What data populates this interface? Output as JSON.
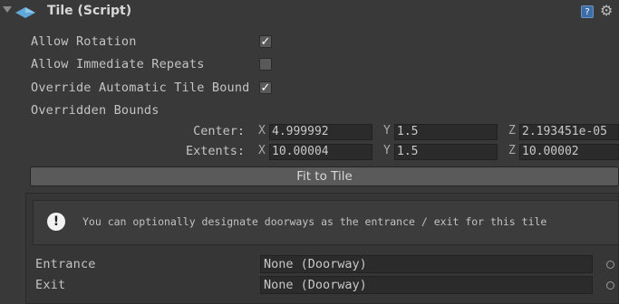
{
  "header": {
    "title": "Tile (Script)",
    "help_icon": "?",
    "gear_icon": "⚙"
  },
  "properties": {
    "allow_rotation": {
      "label": "Allow Rotation",
      "checked": true,
      "mark": "✓"
    },
    "allow_immediate_repeats": {
      "label": "Allow Immediate Repeats",
      "checked": false,
      "mark": ""
    },
    "override_bounds": {
      "label": "Override Automatic Tile Bound",
      "checked": true,
      "mark": "✓"
    },
    "overridden_bounds": {
      "label": "Overridden Bounds"
    }
  },
  "bounds": {
    "center": {
      "label": "Center:",
      "x_label": "X",
      "x": "4.999992",
      "y_label": "Y",
      "y": "1.5",
      "z_label": "Z",
      "z": "2.193451e-05"
    },
    "extents": {
      "label": "Extents:",
      "x_label": "X",
      "x": "10.00004",
      "y_label": "Y",
      "y": "1.5",
      "z_label": "Z",
      "z": "10.00002"
    }
  },
  "fit_button": "Fit to Tile",
  "info": {
    "icon": "!",
    "text": "You can optionally designate doorways as the entrance / exit for this tile"
  },
  "doorways": {
    "entrance": {
      "label": "Entrance",
      "value": "None (Doorway)"
    },
    "exit": {
      "label": "Exit",
      "value": "None (Doorway)"
    }
  },
  "colors": {
    "background": "#393939",
    "field": "#2b2b2b",
    "button": "#5a5a5a",
    "tile_icon": "#5fa8d8"
  }
}
